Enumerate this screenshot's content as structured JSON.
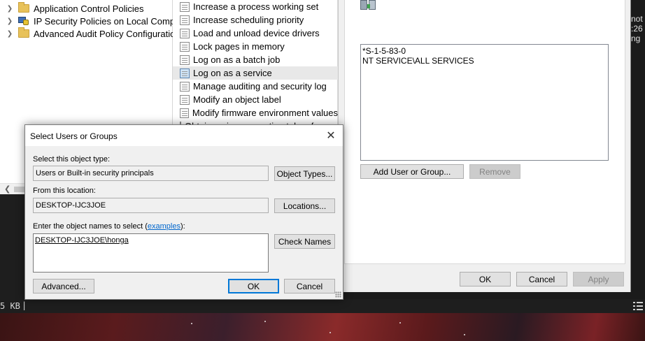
{
  "tree": {
    "items": [
      {
        "label": "Application Control Policies",
        "icon": "folder-icon"
      },
      {
        "label": "IP Security Policies on Local Compute",
        "icon": "ip-security-icon"
      },
      {
        "label": "Advanced Audit Policy Configuration",
        "icon": "folder-icon"
      }
    ]
  },
  "policies": {
    "items": [
      {
        "label": "Increase a process working set"
      },
      {
        "label": "Increase scheduling priority"
      },
      {
        "label": "Load and unload device drivers"
      },
      {
        "label": "Lock pages in memory"
      },
      {
        "label": "Log on as a batch job"
      },
      {
        "label": "Log on as a service",
        "selected": true
      },
      {
        "label": "Manage auditing and security log"
      },
      {
        "label": "Modify an object label"
      },
      {
        "label": "Modify firmware environment values"
      },
      {
        "label": "Obtain an impersonation token for another user in the same session"
      }
    ]
  },
  "properties": {
    "accounts": [
      "*S-1-5-83-0",
      "NT SERVICE\\ALL SERVICES"
    ],
    "add_button": "Add User or Group...",
    "remove_button": "Remove",
    "ok_button": "OK",
    "cancel_button": "Cancel",
    "apply_button": "Apply"
  },
  "dialog": {
    "title": "Select Users or Groups",
    "object_type_label": "Select this object type:",
    "object_type_value": "Users or Built-in security principals",
    "object_types_button": "Object Types...",
    "location_label": "From this location:",
    "location_value": "DESKTOP-IJC3JOE",
    "locations_button": "Locations...",
    "names_label_prefix": "Enter the object names to select (",
    "names_label_link": "examples",
    "names_label_suffix": "):",
    "names_value": "DESKTOP-IJC3JOE\\honga",
    "check_names_button": "Check Names",
    "advanced_button": "Advanced...",
    "ok_button": "OK",
    "cancel_button": "Cancel"
  },
  "statusbar": {
    "size_text": "5 KB",
    "separator": "|"
  },
  "edge_text": [
    "not",
    ":26",
    "ng"
  ]
}
